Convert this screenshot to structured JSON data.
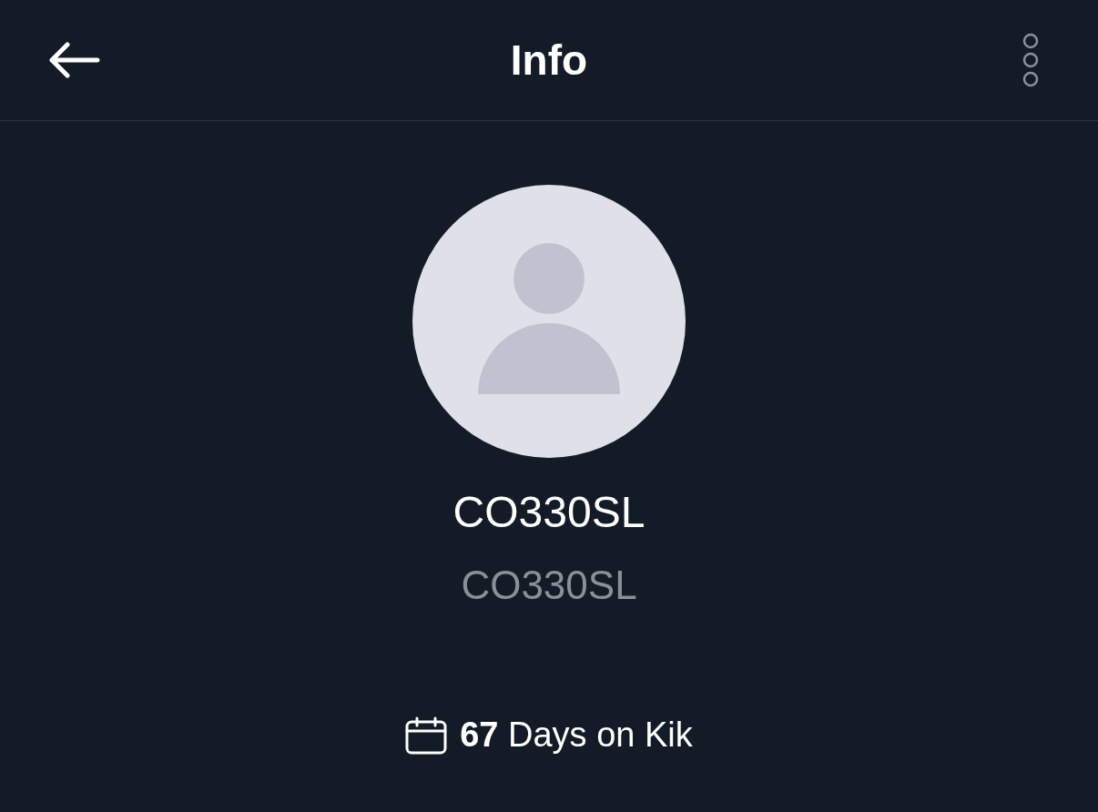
{
  "header": {
    "title": "Info"
  },
  "profile": {
    "display_name": "CO330SL",
    "username": "CO330SL",
    "membership": "**67** Days on Kik"
  }
}
